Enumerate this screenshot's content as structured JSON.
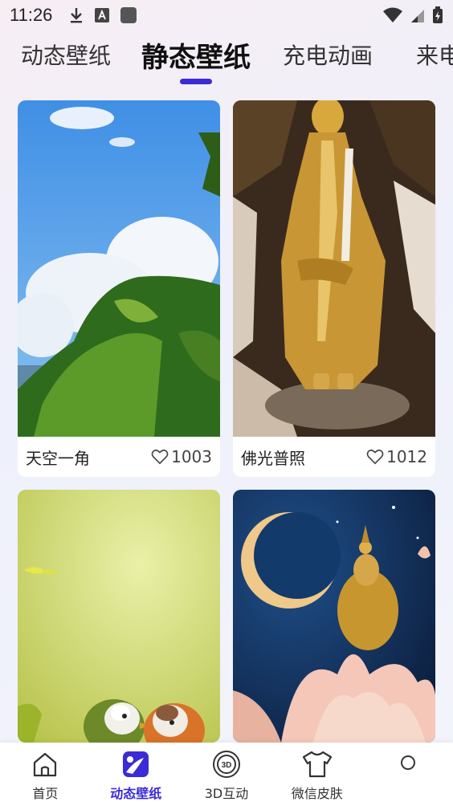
{
  "status": {
    "time": "11:26"
  },
  "tabs": [
    {
      "label": "动态壁纸"
    },
    {
      "label": "静态壁纸"
    },
    {
      "label": "充电动画"
    },
    {
      "label": "来电"
    }
  ],
  "cards": [
    {
      "title": "天空一角",
      "likes": "1003"
    },
    {
      "title": "佛光普照",
      "likes": "1012"
    }
  ],
  "nav": [
    {
      "label": "首页"
    },
    {
      "label": "动态壁纸"
    },
    {
      "label": "3D互动"
    },
    {
      "label": "微信皮肤"
    },
    {
      "label": ""
    }
  ],
  "colors": {
    "accent": "#3b2bd6"
  }
}
